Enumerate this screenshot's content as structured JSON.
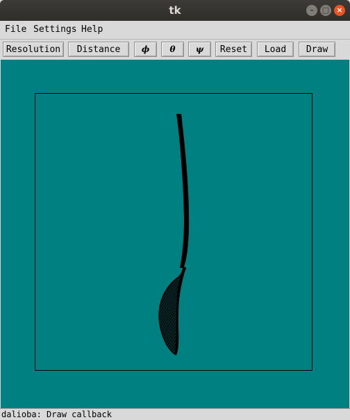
{
  "window": {
    "title": "tk"
  },
  "menu": {
    "items": [
      "File",
      "Settings",
      "Help"
    ]
  },
  "toolbar": {
    "resolution": "Resolution",
    "distance": "Distance",
    "phi": "ϕ",
    "theta": "θ",
    "psi": "ψ",
    "reset": "Reset",
    "load": "Load",
    "draw": "Draw"
  },
  "canvas": {
    "background": "#008080",
    "stroke": "#000000"
  },
  "status": {
    "text": "dalioba: Draw callback"
  }
}
